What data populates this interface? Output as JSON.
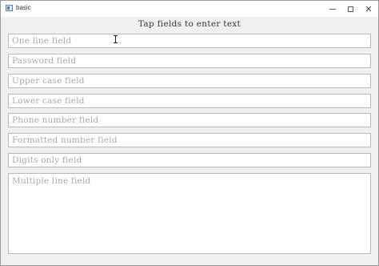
{
  "window": {
    "title": "basic",
    "icon": "app-window-icon",
    "controls": [
      "minimize-icon",
      "maximize-icon",
      "close-icon"
    ]
  },
  "header": {
    "text": "Tap fields to enter text"
  },
  "fields": {
    "one_line": "One line field",
    "password": "Password field",
    "upper_case": "Upper case field",
    "lower_case": "Lower case field",
    "phone": "Phone number field",
    "formatted_number": "Formatted number field",
    "digits_only": "Digits only field",
    "multi_line": "Multiple line field"
  }
}
